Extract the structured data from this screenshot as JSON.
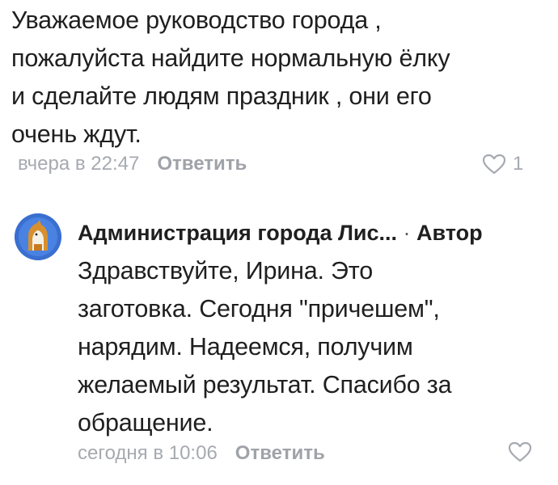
{
  "comment": {
    "text": "Уважаемое руководство города ,\nпожалуйста найдите нормальную ёлку\nи сделайте людям праздник , они его\nочень ждут.",
    "time": "вчера в 22:47",
    "reply_label": "Ответить",
    "likes": "1"
  },
  "reply": {
    "author": "Администрация города Лис...",
    "separator": " · ",
    "badge": "Автор",
    "text": "Здравствуйте, Ирина. Это\nзаготовка. Сегодня \"причешем\",\nнарядим. Надеемся, получим\nжелаемый результат. Спасибо за\nобращение.",
    "time": "сегодня в 10:06",
    "reply_label": "Ответить"
  },
  "colors": {
    "text": "#1f1f1f",
    "meta": "#a6aab0",
    "avatar_bg": "#3a6fd0"
  },
  "icons": {
    "like": "heart-outline-icon",
    "avatar": "fox-emblem"
  }
}
